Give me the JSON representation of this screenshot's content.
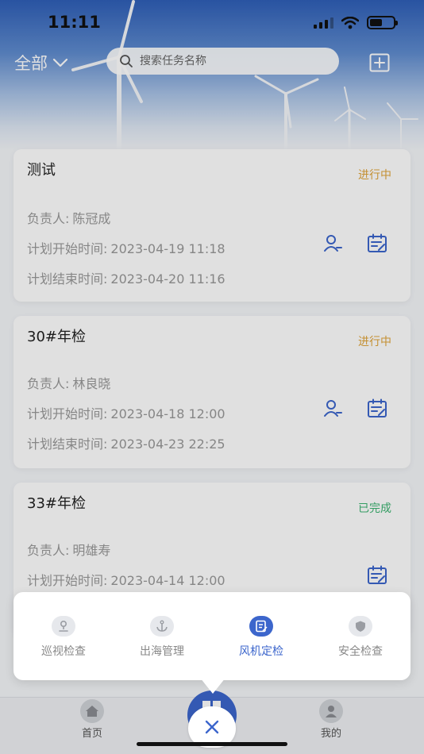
{
  "status_bar": {
    "time": "11:11"
  },
  "header": {
    "filter_label": "全部",
    "search_placeholder": "搜索任务名称"
  },
  "tasks": [
    {
      "title": "测试",
      "status": "进行中",
      "owner_label": "负责人:",
      "owner": "陈冠成",
      "start_label": "计划开始时间:",
      "start": "2023-04-19 11:18",
      "end_label": "计划结束时间:",
      "end": "2023-04-20 11:16"
    },
    {
      "title": "30#年检",
      "status": "进行中",
      "owner_label": "负责人:",
      "owner": "林良晓",
      "start_label": "计划开始时间:",
      "start": "2023-04-18 12:00",
      "end_label": "计划结束时间:",
      "end": "2023-04-23 22:25"
    },
    {
      "title": "33#年检",
      "status": "已完成",
      "owner_label": "负责人:",
      "owner": "明雄寿",
      "start_label": "计划开始时间:",
      "start": "2023-04-14 12:00"
    }
  ],
  "popup_menu": {
    "items": [
      {
        "label": "巡视检查",
        "icon": "patrol-icon"
      },
      {
        "label": "出海管理",
        "icon": "anchor-icon"
      },
      {
        "label": "风机定检",
        "icon": "checklist-icon",
        "active": true
      },
      {
        "label": "安全检查",
        "icon": "shield-icon"
      }
    ]
  },
  "tabbar": {
    "home_label": "首页",
    "mine_label": "我的"
  },
  "colors": {
    "accent": "#3c66cc",
    "status_ongoing": "#e0a43a",
    "status_done": "#3cb371"
  }
}
